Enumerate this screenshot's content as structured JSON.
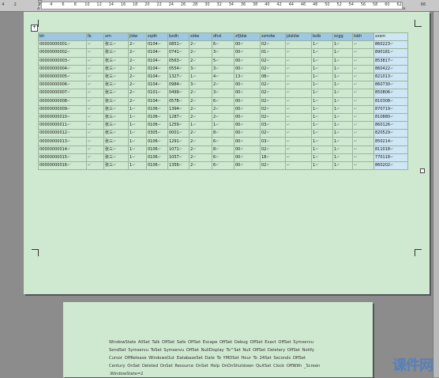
{
  "ruler": {
    "ticks": [
      "4",
      "2",
      "",
      "2",
      "4",
      "6",
      "8",
      "10",
      "12",
      "14",
      "16",
      "18",
      "20",
      "22",
      "24",
      "26",
      "28",
      "30",
      "32",
      "34",
      "36",
      "38",
      "40",
      "42",
      "44",
      "46",
      "48",
      "50",
      "52",
      "54",
      "56",
      "58",
      "60",
      "62",
      "",
      "66"
    ]
  },
  "table": {
    "headers": [
      "bh",
      "lb",
      "xm",
      "jldw",
      "zqdh",
      "bzdh",
      "sldw",
      "dhsl",
      "zfjldw",
      "zzmdw",
      "jdsldw",
      "bslb",
      "zcgg",
      "lsbh",
      "xzsm"
    ],
    "rows": [
      [
        "00000000001",
        "",
        "张三",
        "2",
        "0104",
        "0851",
        "2",
        "6",
        "00",
        "02",
        "",
        "1",
        "1",
        "",
        "860223"
      ],
      [
        "00000000002",
        "",
        "张三",
        "2",
        "0104",
        "0741",
        "2",
        "3",
        "00",
        "01",
        "",
        "1",
        "1",
        "",
        "890181"
      ],
      [
        "00000000003",
        "",
        "张三",
        "2",
        "0104",
        "0563",
        "2",
        "5",
        "00",
        "02",
        "",
        "1",
        "1",
        "",
        "853817"
      ],
      [
        "00000000004",
        "",
        "张三",
        "2",
        "0104",
        "0554",
        "3",
        "3",
        "00",
        "02",
        "",
        "1",
        "1",
        "",
        "860422"
      ],
      [
        "00000000005",
        "",
        "张三",
        "2",
        "0104",
        "1327",
        "1",
        "4",
        "13",
        "08",
        "",
        "1",
        "1",
        "",
        "821013"
      ],
      [
        "00000000006",
        "",
        "张三",
        "2",
        "0104",
        "0984",
        "3",
        "2",
        "00",
        "02",
        "",
        "1",
        "1",
        "",
        "860730"
      ],
      [
        "00000000007",
        "",
        "张三",
        "2",
        "0101",
        "0499",
        "2",
        "3",
        "00",
        "02",
        "",
        "1",
        "1",
        "",
        "850806"
      ],
      [
        "00000000008",
        "",
        "张三",
        "2",
        "0104",
        "0578",
        "2",
        "6",
        "00",
        "02",
        "",
        "1",
        "1",
        "",
        "810308"
      ],
      [
        "00000000009",
        "",
        "张三",
        "1",
        "0106",
        "1394",
        "2",
        "2",
        "00",
        "02",
        "",
        "1",
        "1",
        "",
        "870719"
      ],
      [
        "00000000010",
        "",
        "张三",
        "1",
        "0106",
        "1287",
        "2",
        "2",
        "00",
        "02",
        "",
        "1",
        "1",
        "",
        "810880"
      ],
      [
        "00000000011",
        "",
        "张三",
        "1",
        "0106",
        "1259",
        "1",
        "1",
        "00",
        "03",
        "",
        "1",
        "1",
        "",
        "860126"
      ],
      [
        "00000000012",
        "",
        "张三",
        "1",
        "0305",
        "0001",
        "2",
        "8",
        "00",
        "02",
        "",
        "1",
        "1",
        "",
        "820529"
      ],
      [
        "00000000013",
        "",
        "张三",
        "1",
        "0106",
        "1291",
        "2",
        "6",
        "00",
        "03",
        "",
        "1",
        "1",
        "",
        "850214"
      ],
      [
        "00000000014",
        "",
        "张三",
        "1",
        "0106",
        "1071",
        "2",
        "8",
        "00",
        "02",
        "",
        "1",
        "1",
        "",
        "811018"
      ],
      [
        "00000000015",
        "",
        "张三",
        "1",
        "0106",
        "1057",
        "2",
        "6",
        "00",
        "18",
        "",
        "1",
        "1",
        "",
        "770118"
      ],
      [
        "00000000016",
        "",
        "张三",
        "1",
        "0106",
        "1356",
        "2",
        "6",
        "00",
        "02",
        "",
        "1",
        "1",
        "",
        "860202"
      ]
    ]
  },
  "page2": {
    "text": "WindowState AllSet Talk OffSet Safe OffSet Escape OffSet Debug OffSet Exact OffSet Symservu SendSet Symservu ToSet Symservu OffSet NullDisplay To^Set Null OffSet Deletery OffSet Notify Cursor OffRelease WindowsOut DatabaseSet Date To YMDSet Hour To 24Set Seconds OffSet Century OnSet Deleted OnSet Resource OnSet Help OnOnShutdown QuitSet Clock OffWith _Screen .WindowState=2"
  },
  "watermark": {
    "text": "课件网"
  }
}
